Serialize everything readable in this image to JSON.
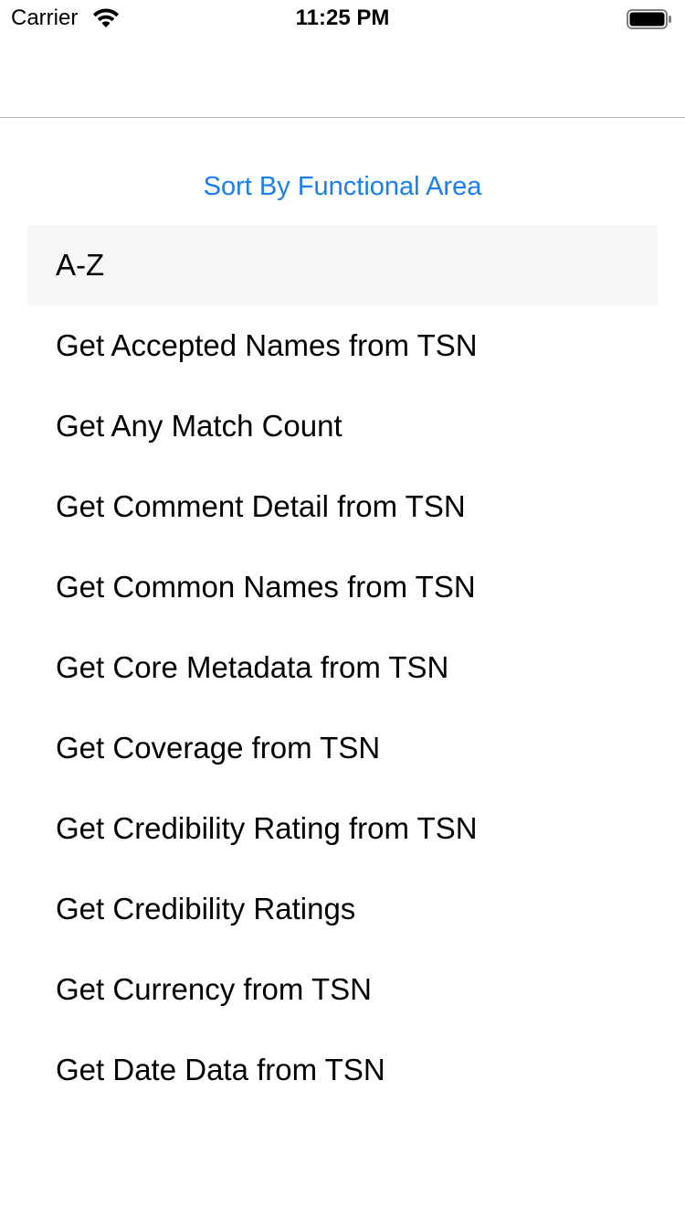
{
  "status_bar": {
    "carrier": "Carrier",
    "time": "11:25 PM",
    "wifi_icon": "wifi-icon",
    "battery_icon": "battery-full-icon"
  },
  "sort_button": {
    "label": "Sort By Functional Area",
    "color": "#1a7ff0"
  },
  "list": {
    "selected_index": 0,
    "selected_background": "#f6f6f6",
    "items": [
      {
        "label": "A-Z"
      },
      {
        "label": "Get Accepted Names from TSN"
      },
      {
        "label": "Get Any Match Count"
      },
      {
        "label": "Get Comment Detail from TSN"
      },
      {
        "label": "Get Common Names from TSN"
      },
      {
        "label": "Get Core Metadata from TSN"
      },
      {
        "label": "Get Coverage from TSN"
      },
      {
        "label": "Get Credibility Rating from TSN"
      },
      {
        "label": "Get Credibility Ratings"
      },
      {
        "label": "Get Currency from TSN"
      },
      {
        "label": "Get Date Data from TSN"
      }
    ]
  }
}
